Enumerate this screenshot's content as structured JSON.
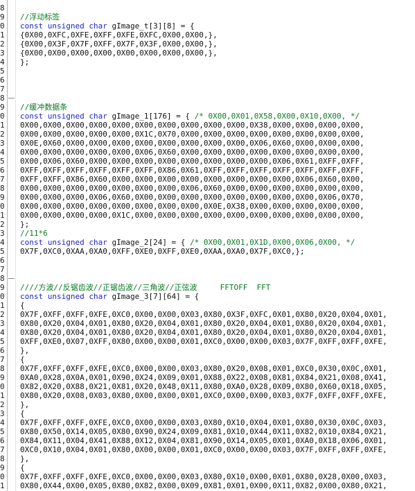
{
  "colors": {
    "comment": "#0a7a22",
    "keyword": "#1a22c8",
    "text": "#101010",
    "background": "#ffffff"
  },
  "editor": {
    "lines": [
      {
        "ln": "8",
        "fold": false,
        "parts": []
      },
      {
        "ln": "9",
        "fold": false,
        "parts": [
          {
            "t": "//浮动标签",
            "c": "comment"
          }
        ]
      },
      {
        "ln": "0",
        "fold": false,
        "parts": [
          {
            "t": "const unsigned char",
            "c": "keyword"
          },
          {
            "t": " gImage_t[3][8] = {",
            "c": "text"
          }
        ]
      },
      {
        "ln": "1",
        "fold": false,
        "parts": [
          {
            "t": "{0X00,0XFC,0XFE,0XFF,0XFE,0XFC,0X00,0X00,},",
            "c": "text"
          }
        ]
      },
      {
        "ln": "2",
        "fold": false,
        "parts": [
          {
            "t": "{0X00,0X3F,0X7F,0XFF,0X7F,0X3F,0X00,0X00,},",
            "c": "text"
          }
        ]
      },
      {
        "ln": "3",
        "fold": false,
        "parts": [
          {
            "t": "{0X00,0X00,0X00,0X00,0X00,0X00,0X00,0X00,},",
            "c": "text"
          }
        ]
      },
      {
        "ln": "4",
        "fold": false,
        "parts": [
          {
            "t": "};",
            "c": "text"
          }
        ]
      },
      {
        "ln": "5",
        "fold": false,
        "parts": []
      },
      {
        "ln": "6",
        "fold": false,
        "parts": []
      },
      {
        "ln": "7",
        "fold": false,
        "parts": []
      },
      {
        "ln": "8",
        "fold": true,
        "parts": []
      },
      {
        "ln": "9",
        "fold": false,
        "parts": [
          {
            "t": "//缓冲数据条",
            "c": "comment"
          }
        ]
      },
      {
        "ln": "0",
        "fold": false,
        "parts": [
          {
            "t": "const unsigned char",
            "c": "keyword"
          },
          {
            "t": " gImage_1[176] = { ",
            "c": "text"
          },
          {
            "t": "/* 0X00,0X01,0X58,0X00,0X10,0X00, */",
            "c": "comment"
          }
        ]
      },
      {
        "ln": "1",
        "fold": false,
        "parts": [
          {
            "t": "0X00,0X00,0X00,0X00,0X00,0X00,0X00,0X00,0X00,0X00,0X38,0X00,0X00,0X00,0X00,",
            "c": "text"
          }
        ]
      },
      {
        "ln": "2",
        "fold": false,
        "parts": [
          {
            "t": "0X00,0X00,0X00,0X00,0X00,0X1C,0X70,0X00,0X00,0X00,0X00,0X00,0X00,0X00,0X00,",
            "c": "text"
          }
        ]
      },
      {
        "ln": "3",
        "fold": false,
        "parts": [
          {
            "t": "0X0E,0X60,0X00,0X00,0X00,0X00,0X00,0X00,0X00,0X00,0X06,0X60,0X00,0X00,0X00,",
            "c": "text"
          }
        ]
      },
      {
        "ln": "4",
        "fold": false,
        "parts": [
          {
            "t": "0X00,0X00,0X00,0X00,0X00,0X06,0X60,0X00,0X00,0X00,0X00,0X00,0X00,0X00,0X00,",
            "c": "text"
          }
        ]
      },
      {
        "ln": "5",
        "fold": false,
        "parts": [
          {
            "t": "0X00,0X06,0X60,0X00,0X00,0X00,0X00,0X00,0X00,0X00,0X00,0X06,0X61,0XFF,0XFF,",
            "c": "text"
          }
        ]
      },
      {
        "ln": "6",
        "fold": false,
        "parts": [
          {
            "t": "0XFF,0XFF,0XFF,0XFF,0XFF,0XFF,0X86,0X61,0XFF,0XFF,0XFF,0XFF,0XFF,0XFF,0XFF,",
            "c": "text"
          }
        ]
      },
      {
        "ln": "7",
        "fold": false,
        "parts": [
          {
            "t": "0XFF,0XFF,0X86,0X60,0X00,0X00,0X00,0X00,0X00,0X00,0X00,0X00,0X06,0X60,0X00,",
            "c": "text"
          }
        ]
      },
      {
        "ln": "8",
        "fold": false,
        "parts": [
          {
            "t": "0X00,0X00,0X00,0X00,0X00,0X00,0X00,0X06,0X60,0X00,0X00,0X00,0X00,0X00,0X00,",
            "c": "text"
          }
        ]
      },
      {
        "ln": "9",
        "fold": false,
        "parts": [
          {
            "t": "0X00,0X00,0X00,0X06,0X60,0X00,0X00,0X00,0X00,0X00,0X00,0X00,0X00,0X06,0X70,",
            "c": "text"
          }
        ]
      },
      {
        "ln": "0",
        "fold": false,
        "parts": [
          {
            "t": "0X00,0X00,0X00,0X00,0X00,0X00,0X00,0X00,0X0E,0X38,0X00,0X00,0X00,0X00,0X00,",
            "c": "text"
          }
        ]
      },
      {
        "ln": "1",
        "fold": false,
        "parts": [
          {
            "t": "0X00,0X00,0X00,0X00,0X1C,0X00,0X00,0X00,0X00,0X00,0X00,0X00,0X00,0X00,0X00,",
            "c": "text"
          }
        ]
      },
      {
        "ln": "2",
        "fold": false,
        "parts": [
          {
            "t": "};",
            "c": "text"
          }
        ]
      },
      {
        "ln": "3",
        "fold": false,
        "parts": [
          {
            "t": "//11*6",
            "c": "comment"
          }
        ]
      },
      {
        "ln": "4",
        "fold": false,
        "parts": [
          {
            "t": "const unsigned char",
            "c": "keyword"
          },
          {
            "t": " gImage_2[24] = { ",
            "c": "text"
          },
          {
            "t": "/* 0X00,0X01,0X1D,0X00,0X06,0X00, */",
            "c": "comment"
          }
        ]
      },
      {
        "ln": "5",
        "fold": false,
        "parts": [
          {
            "t": "0X7F,0XC0,0XAA,0XA0,0XFF,0XE0,0XFF,0XE0,0XAA,0XA0,0X7F,0XC0,};",
            "c": "text"
          }
        ]
      },
      {
        "ln": "6",
        "fold": false,
        "parts": []
      },
      {
        "ln": "7",
        "fold": false,
        "parts": []
      },
      {
        "ln": "8",
        "fold": true,
        "parts": []
      },
      {
        "ln": "9",
        "fold": false,
        "parts": [
          {
            "t": "////方波//反锯齿波//正锯齿波//三角波//正弦波     FFTOFF  FFT",
            "c": "comment"
          }
        ]
      },
      {
        "ln": "0",
        "fold": false,
        "parts": [
          {
            "t": "const unsigned char",
            "c": "keyword"
          },
          {
            "t": " gImage_3[7][64] = {",
            "c": "text"
          }
        ]
      },
      {
        "ln": "1",
        "fold": false,
        "parts": [
          {
            "t": "{",
            "c": "text"
          }
        ]
      },
      {
        "ln": "2",
        "fold": false,
        "parts": [
          {
            "t": "0X7F,0XFF,0XFF,0XFE,0XC0,0X00,0X00,0X03,0X80,0X3F,0XFC,0X01,0X80,0X20,0X04,0X01,",
            "c": "text"
          }
        ]
      },
      {
        "ln": "3",
        "fold": false,
        "parts": [
          {
            "t": "0X80,0X20,0X04,0X01,0X80,0X20,0X04,0X01,0X80,0X20,0X04,0X01,0X80,0X20,0X04,0X01,",
            "c": "text"
          }
        ]
      },
      {
        "ln": "4",
        "fold": false,
        "parts": [
          {
            "t": "0X80,0X20,0X04,0X01,0X80,0X20,0X04,0X01,0X80,0X20,0X04,0X01,0X80,0X20,0X04,0X01,",
            "c": "text"
          }
        ]
      },
      {
        "ln": "5",
        "fold": false,
        "parts": [
          {
            "t": "0XFF,0XE0,0X07,0XFF,0X80,0X00,0X00,0X01,0XC0,0X00,0X00,0X03,0X7F,0XFF,0XFF,0XFE,",
            "c": "text"
          }
        ]
      },
      {
        "ln": "6",
        "fold": false,
        "parts": [
          {
            "t": "},",
            "c": "text"
          }
        ]
      },
      {
        "ln": "7",
        "fold": false,
        "parts": [
          {
            "t": "{",
            "c": "text"
          }
        ]
      },
      {
        "ln": "8",
        "fold": false,
        "parts": [
          {
            "t": "0X7F,0XFF,0XFF,0XFE,0XC0,0X00,0X00,0X03,0X80,0X20,0X08,0X01,0XC0,0X30,0X0C,0X01,",
            "c": "text"
          }
        ]
      },
      {
        "ln": "9",
        "fold": false,
        "parts": [
          {
            "t": "0XA0,0X28,0X0A,0X01,0X90,0X24,0X09,0X01,0X88,0X22,0X08,0X81,0X84,0X21,0X08,0X41,",
            "c": "text"
          }
        ]
      },
      {
        "ln": "0",
        "fold": false,
        "parts": [
          {
            "t": "0X82,0X20,0X88,0X21,0X81,0X20,0X48,0X11,0X80,0XA0,0X28,0X09,0X80,0X60,0X18,0X05,",
            "c": "text"
          }
        ]
      },
      {
        "ln": "1",
        "fold": false,
        "parts": [
          {
            "t": "0X80,0X20,0X08,0X03,0X80,0X00,0X00,0X01,0XC0,0X00,0X00,0X03,0X7F,0XFF,0XFF,0XFE,",
            "c": "text"
          }
        ]
      },
      {
        "ln": "2",
        "fold": false,
        "parts": [
          {
            "t": "},",
            "c": "text"
          }
        ]
      },
      {
        "ln": "3",
        "fold": false,
        "parts": [
          {
            "t": "{",
            "c": "text"
          }
        ]
      },
      {
        "ln": "4",
        "fold": false,
        "parts": [
          {
            "t": "0X7F,0XFF,0XFF,0XFE,0XC0,0X00,0X00,0X03,0X80,0X10,0X04,0X01,0X80,0X30,0X0C,0X03,",
            "c": "text"
          }
        ]
      },
      {
        "ln": "5",
        "fold": false,
        "parts": [
          {
            "t": "0X80,0X50,0X14,0X05,0X80,0X90,0X24,0X09,0X81,0X10,0X44,0X11,0X82,0X10,0X84,0X21,",
            "c": "text"
          }
        ]
      },
      {
        "ln": "6",
        "fold": false,
        "parts": [
          {
            "t": "0X84,0X11,0X04,0X41,0X88,0X12,0X04,0X81,0X90,0X14,0X05,0X01,0XA0,0X18,0X06,0X01,",
            "c": "text"
          }
        ]
      },
      {
        "ln": "7",
        "fold": false,
        "parts": [
          {
            "t": "0XC0,0X10,0X04,0X01,0X80,0X00,0X00,0X01,0XC0,0X00,0X00,0X03,0X7F,0XFF,0XFF,0XFE,",
            "c": "text"
          }
        ]
      },
      {
        "ln": "8",
        "fold": false,
        "parts": [
          {
            "t": "},",
            "c": "text"
          }
        ]
      },
      {
        "ln": "9",
        "fold": false,
        "parts": [
          {
            "t": "{",
            "c": "text"
          }
        ]
      },
      {
        "ln": "0",
        "fold": false,
        "parts": [
          {
            "t": "0X7F,0XFF,0XFF,0XFE,0XC0,0X00,0X00,0X03,0X80,0X10,0X00,0X01,0X80,0X28,0X00,0X03,",
            "c": "text"
          }
        ]
      },
      {
        "ln": "1",
        "fold": false,
        "parts": [
          {
            "t": "0X80,0X44,0X00,0X05,0X80,0X82,0X00,0X09,0X81,0X01,0X00,0X11,0X82,0X00,0X80,0X21,",
            "c": "text"
          }
        ]
      }
    ]
  }
}
